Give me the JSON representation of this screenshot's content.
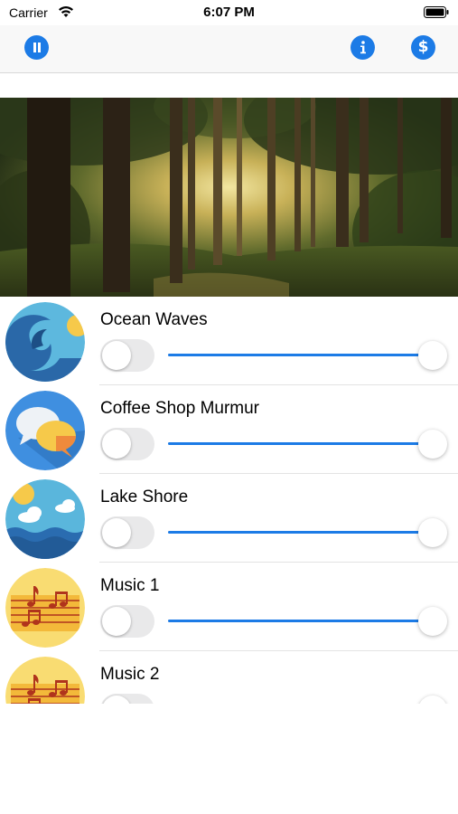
{
  "status_bar": {
    "carrier": "Carrier",
    "time": "6:07 PM",
    "wifi_icon": "wifi-icon",
    "battery_icon": "battery-icon"
  },
  "toolbar": {
    "left_button_icon": "pause-icon",
    "right_buttons": [
      "info-icon",
      "dollar-icon"
    ],
    "accent_color": "#1c7be6"
  },
  "hero": {
    "image": "forest-image"
  },
  "sounds": [
    {
      "title": "Ocean Waves",
      "icon": "ocean-waves-icon",
      "enabled": false,
      "volume": 0.95
    },
    {
      "title": "Coffee Shop Murmur",
      "icon": "chat-bubbles-icon",
      "enabled": false,
      "volume": 0.95
    },
    {
      "title": "Lake Shore",
      "icon": "lake-shore-icon",
      "enabled": false,
      "volume": 0.95
    },
    {
      "title": "Music 1",
      "icon": "music-notes-icon",
      "enabled": false,
      "volume": 0.95
    },
    {
      "title": "Music 2",
      "icon": "music-notes-icon",
      "enabled": false,
      "volume": 0.95
    }
  ]
}
